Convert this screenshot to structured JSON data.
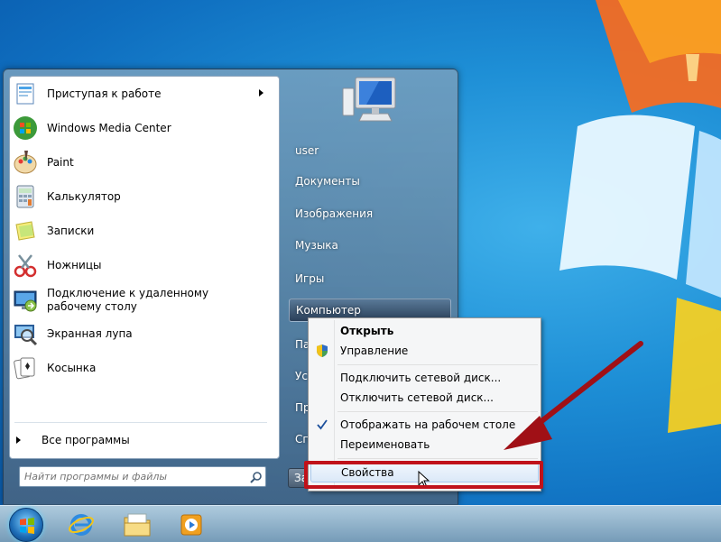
{
  "start_menu": {
    "programs": [
      {
        "label": "Приступая к работе",
        "icon": "getting-started-icon",
        "has_submenu": true
      },
      {
        "label": "Windows Media Center",
        "icon": "media-center-icon"
      },
      {
        "label": "Paint",
        "icon": "paint-icon"
      },
      {
        "label": "Калькулятор",
        "icon": "calculator-icon"
      },
      {
        "label": "Записки",
        "icon": "sticky-notes-icon"
      },
      {
        "label": "Ножницы",
        "icon": "snipping-tool-icon"
      },
      {
        "label": "Подключение к удаленному рабочему столу",
        "icon": "remote-desktop-icon"
      },
      {
        "label": "Экранная лупа",
        "icon": "magnifier-icon"
      },
      {
        "label": "Косынка",
        "icon": "solitaire-icon"
      }
    ],
    "all_programs": "Все программы",
    "search_placeholder": "Найти программы и файлы",
    "right_items": [
      {
        "label": "user"
      },
      {
        "label": "Документы"
      },
      {
        "label": "Изображения"
      },
      {
        "label": "Музыка"
      },
      {
        "label": "Игры"
      },
      {
        "label": "Компьютер",
        "highlighted": true
      },
      {
        "label": "Па"
      },
      {
        "label": "Уст"
      },
      {
        "label": "Пр"
      },
      {
        "label": "Сп"
      }
    ],
    "shutdown_label": "За"
  },
  "context_menu": {
    "items": [
      {
        "label": "Открыть",
        "bold": true
      },
      {
        "label": "Управление",
        "icon": "shield-icon"
      },
      {
        "label": "Подключить сетевой диск..."
      },
      {
        "label": "Отключить сетевой диск..."
      },
      {
        "label": "Отображать на рабочем столе",
        "checked": true
      },
      {
        "label": "Переименовать"
      },
      {
        "label": "Свойства",
        "hovered": true
      }
    ]
  },
  "colors": {
    "annotation": "#c0121a",
    "desktop": "#1e8fd6"
  }
}
